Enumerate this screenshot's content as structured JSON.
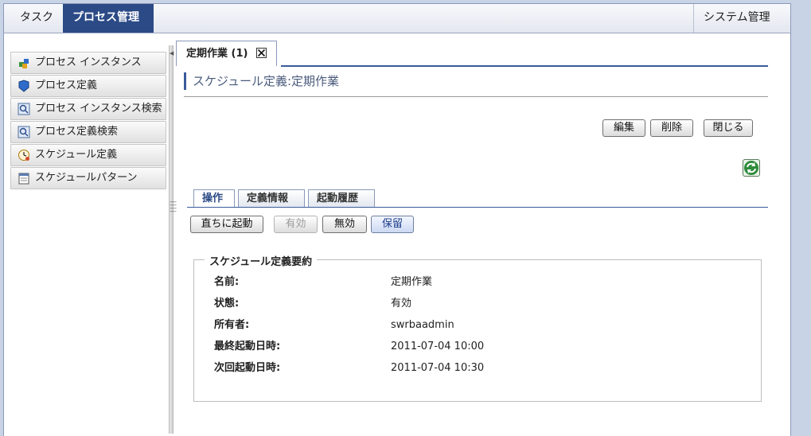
{
  "topnav": {
    "tabs": [
      "タスク",
      "プロセス管理"
    ],
    "right_tab": "システム管理"
  },
  "menu": {
    "items": [
      {
        "label": "プロセス インスタンス",
        "icon": "process-instance-icon"
      },
      {
        "label": "プロセス定義",
        "icon": "process-definition-icon"
      },
      {
        "label": "プロセス インスタンス検索",
        "icon": "search-icon"
      },
      {
        "label": "プロセス定義検索",
        "icon": "search-icon"
      },
      {
        "label": "スケジュール定義",
        "icon": "clock-icon"
      },
      {
        "label": "スケジュールパターン",
        "icon": "calendar-icon"
      }
    ]
  },
  "doc_tab": {
    "label": "定期作業 (1)"
  },
  "page": {
    "title": "スケジュール定義:定期作業"
  },
  "toolbar": {
    "edit": "編集",
    "delete": "削除",
    "close": "閉じる"
  },
  "sub_tabs": [
    "操作",
    "定義情報",
    "起動履歴"
  ],
  "actions": {
    "start_now": "直ちに起動",
    "enable": "有効",
    "disable": "無効",
    "hold": "保留"
  },
  "summary": {
    "legend": "スケジュール定義要約",
    "rows": [
      {
        "label": "名前:",
        "value": "定期作業"
      },
      {
        "label": "状態:",
        "value": "有効"
      },
      {
        "label": "所有者:",
        "value": "swrbaadmin"
      },
      {
        "label": "最終起動日時:",
        "value": "2011-07-04 10:00"
      },
      {
        "label": "次回起動日時:",
        "value": "2011-07-04 10:30"
      }
    ]
  },
  "colors": {
    "accent": "#2b4a86",
    "title_text": "#4a5b7c"
  }
}
